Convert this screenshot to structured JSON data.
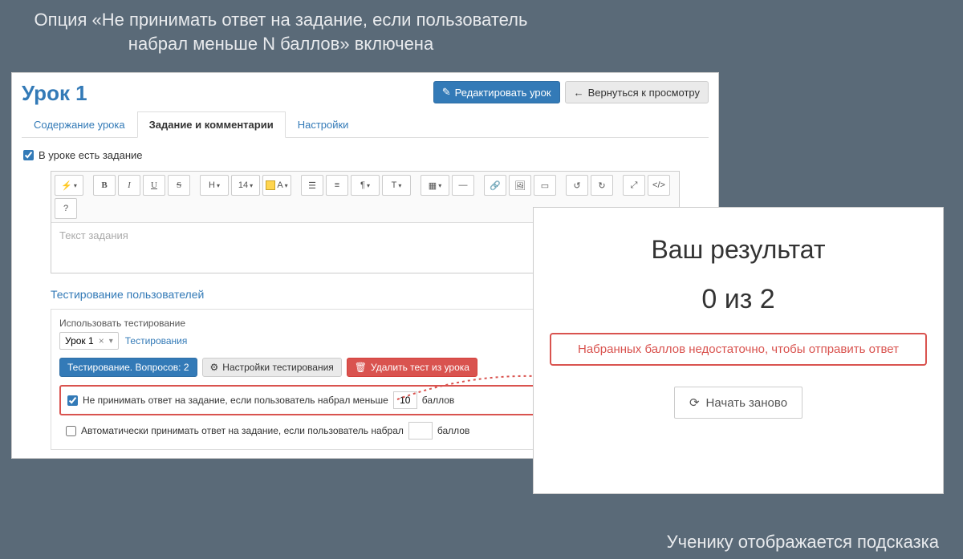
{
  "captions": {
    "top": "Опция «Не принимать ответ на задание, если пользователь набрал меньше N баллов» включена",
    "bottom": "Ученику отображается подсказка"
  },
  "header": {
    "title": "Урок 1",
    "edit_button": "Редактировать урок",
    "back_button": "Вернуться к просмотру"
  },
  "tabs": {
    "content": "Содержание урока",
    "task": "Задание и комментарии",
    "settings": "Настройки"
  },
  "task": {
    "has_task_label": "В уроке есть задание",
    "placeholder": "Текст задания"
  },
  "toolbar": {
    "magic": "✨",
    "bold": "B",
    "italic": "I",
    "underline": "U",
    "strike": "S",
    "h": "H",
    "fh": "14",
    "color": "A",
    "ul": "≡",
    "ol": "≡",
    "para": "¶",
    "lh": "T↕",
    "table": "▦",
    "hr": "—",
    "link": "🔗",
    "image": "🖼",
    "video": "▭",
    "full": "⛶",
    "code": "</>",
    "help": "?",
    "undo": "↺",
    "redo": "↻",
    "expand": "⤢"
  },
  "testing": {
    "section_title": "Тестирование пользователей",
    "use_label": "Использовать тестирование",
    "selected": "Урок 1",
    "link": "Тестирования",
    "questions_btn": "Тестирование. Вопросов: 2",
    "settings_btn": "Настройки тестирования",
    "delete_btn": "Удалить тест из урока",
    "reject_prefix": "Не принимать ответ на задание, если пользователь набрал меньше",
    "reject_value": "10",
    "reject_suffix": "баллов",
    "auto_prefix": "Автоматически принимать ответ на задание, если пользователь набрал",
    "auto_value": "",
    "auto_suffix": "баллов"
  },
  "result": {
    "title": "Ваш результат",
    "score": "0 из 2",
    "alert": "Набранных баллов недостаточно, чтобы отправить ответ",
    "restart": "Начать заново"
  }
}
